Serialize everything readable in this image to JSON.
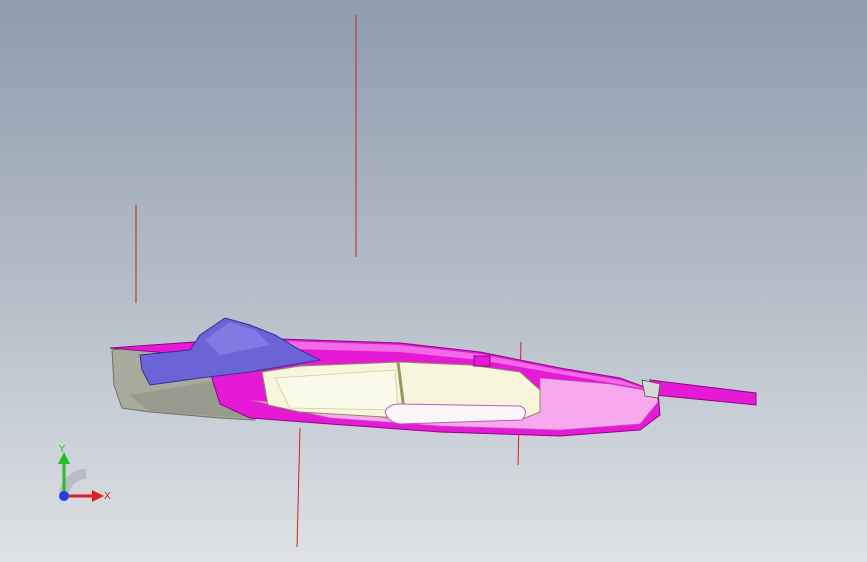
{
  "viewport": {
    "background_top": "#8f9cae",
    "background_bottom": "#dfe2e6"
  },
  "model": {
    "shell_color": "#e619d6",
    "inner_color": "#f7a8ee",
    "window_color": "#f7f5dc",
    "cap_color": "#6b63d6",
    "base_color": "#a9ab9c",
    "guide_line_color": "#d42020"
  },
  "triad": {
    "x_label": "X",
    "y_label": "Y",
    "x_color": "#e02020",
    "y_color": "#22c022",
    "z_color": "#2040e0"
  }
}
